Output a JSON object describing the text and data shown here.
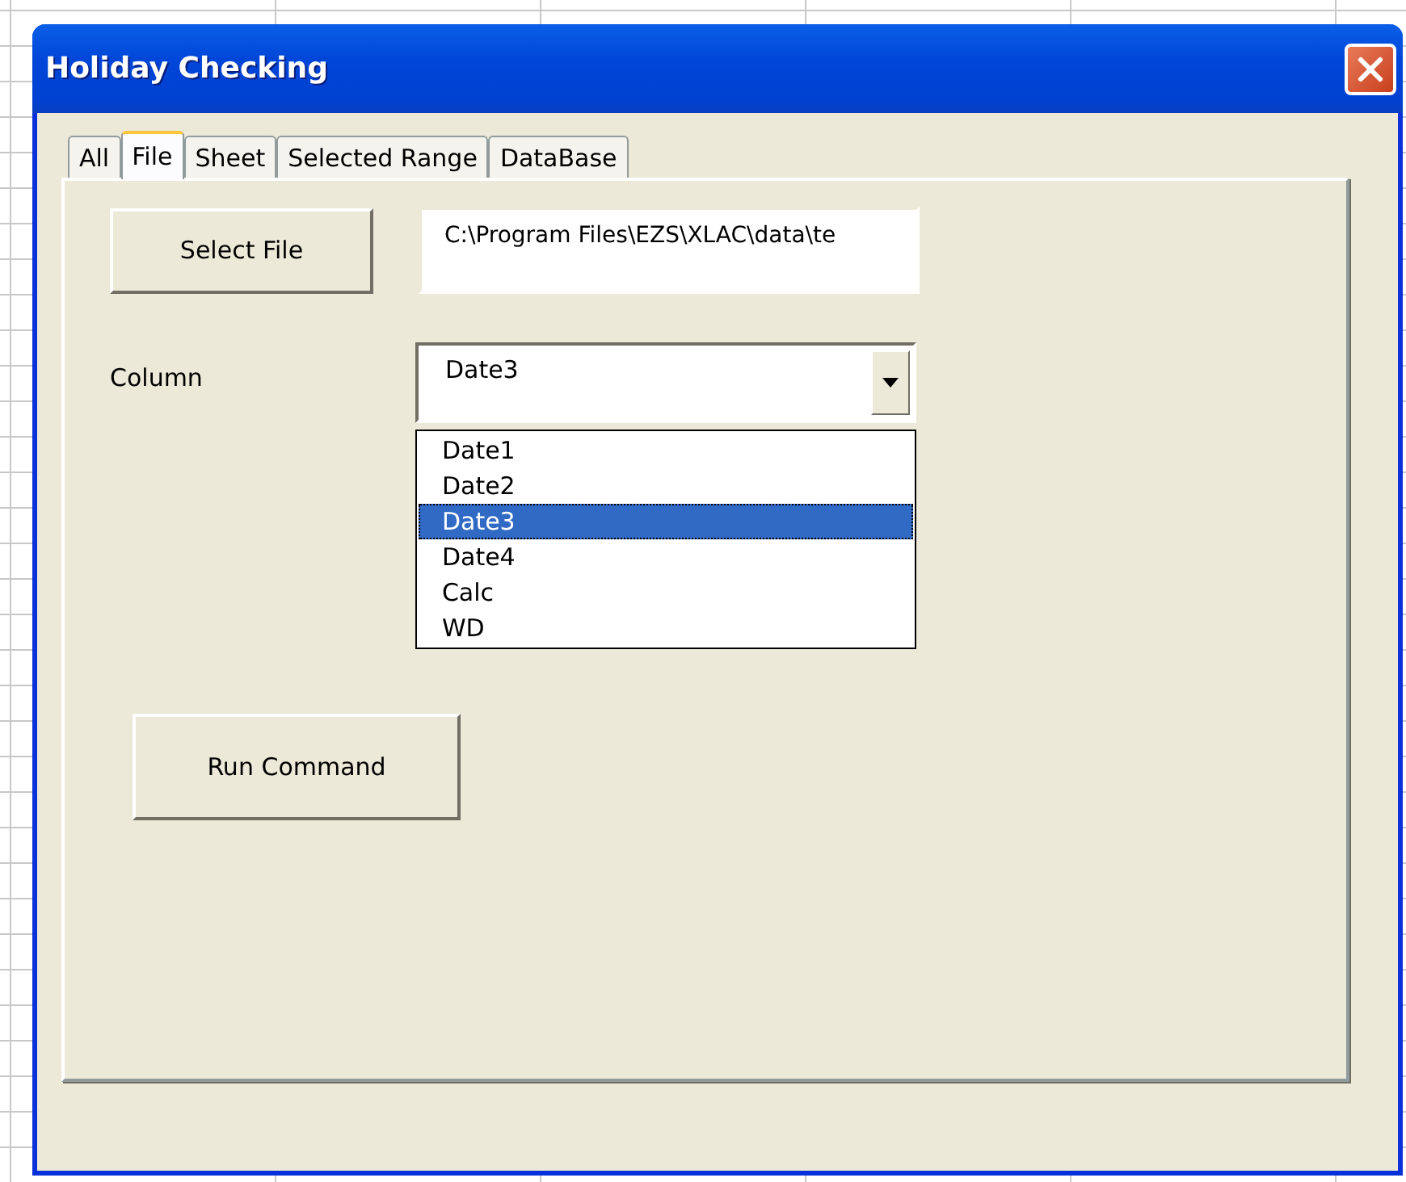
{
  "window": {
    "title": "Holiday Checking"
  },
  "tabs": [
    {
      "label": "All",
      "selected": false
    },
    {
      "label": "File",
      "selected": true
    },
    {
      "label": "Sheet",
      "selected": false
    },
    {
      "label": "Selected Range",
      "selected": false
    },
    {
      "label": "DataBase",
      "selected": false
    }
  ],
  "select_file_button": "Select File",
  "file_path": {
    "value": "C:\\Program Files\\EZS\\XLAC\\data\\te"
  },
  "column": {
    "label": "Column",
    "value": "Date3",
    "options": [
      {
        "label": "Date1",
        "selected": false
      },
      {
        "label": "Date2",
        "selected": false
      },
      {
        "label": "Date3",
        "selected": true
      },
      {
        "label": "Date4",
        "selected": false
      },
      {
        "label": "Calc",
        "selected": false
      },
      {
        "label": "WD",
        "selected": false
      }
    ]
  },
  "run_command_button": "Run Command"
}
